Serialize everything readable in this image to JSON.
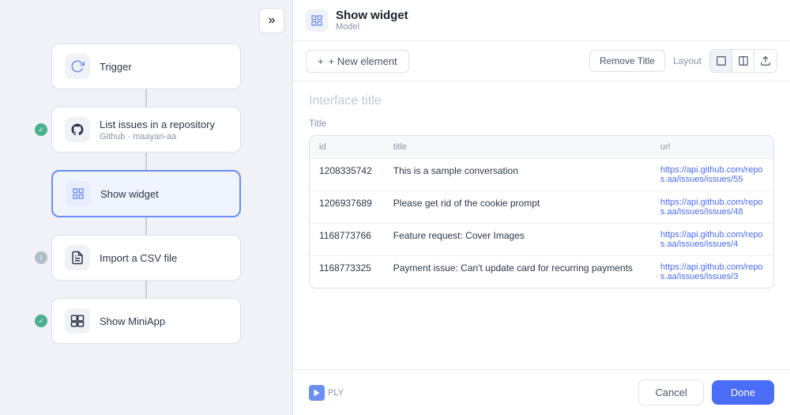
{
  "leftPanel": {
    "collapseBtn": "»",
    "nodes": [
      {
        "id": "trigger",
        "title": "Trigger",
        "subtitle": "",
        "status": null,
        "active": false,
        "iconType": "refresh"
      },
      {
        "id": "list-issues",
        "title": "List issues in a repository",
        "subtitle": "Github · maayan-aa",
        "status": "check",
        "active": false,
        "iconType": "github"
      },
      {
        "id": "show-widget",
        "title": "Show widget",
        "subtitle": "",
        "status": null,
        "active": true,
        "iconType": "widget"
      },
      {
        "id": "import-csv",
        "title": "Import a CSV file",
        "subtitle": "",
        "status": "info",
        "active": false,
        "iconType": "csv"
      },
      {
        "id": "show-miniapp",
        "title": "Show MiniApp",
        "subtitle": "",
        "status": "check",
        "active": false,
        "iconType": "miniapp"
      }
    ]
  },
  "rightPanel": {
    "header": {
      "title": "Show widget",
      "subtitle": "Model",
      "iconType": "widget"
    },
    "toolbar": {
      "newElementLabel": "+ New element",
      "removeTitleLabel": "Remove Title",
      "layoutLabel": "Layout"
    },
    "content": {
      "interfaceTitlePlaceholder": "Interface title",
      "fieldLabel": "Title",
      "table": {
        "columns": [
          "id",
          "title",
          "url"
        ],
        "rows": [
          {
            "id": "1208335742",
            "title": "This is a sample conversation",
            "url": "https://api.github.com/repos.aa/issues/issues/55"
          },
          {
            "id": "1206937689",
            "title": "Please get rid of the cookie prompt",
            "url": "https://api.github.com/repos.aa/issues/issues/48"
          },
          {
            "id": "1168773766",
            "title": "Feature request: Cover Images",
            "url": "https://api.github.com/repos.aa/issues/issues/4"
          },
          {
            "id": "1168773325",
            "title": "Payment issue: Can't update card for recurring payments",
            "url": "https://api.github.com/repos.aa/issues/issues/3"
          }
        ]
      }
    },
    "footer": {
      "logoText": "PLY",
      "cancelLabel": "Cancel",
      "doneLabel": "Done"
    }
  },
  "icons": {
    "chevronRight": "»",
    "plus": "+",
    "square": "□",
    "columns": "⊟",
    "export": "↗"
  }
}
